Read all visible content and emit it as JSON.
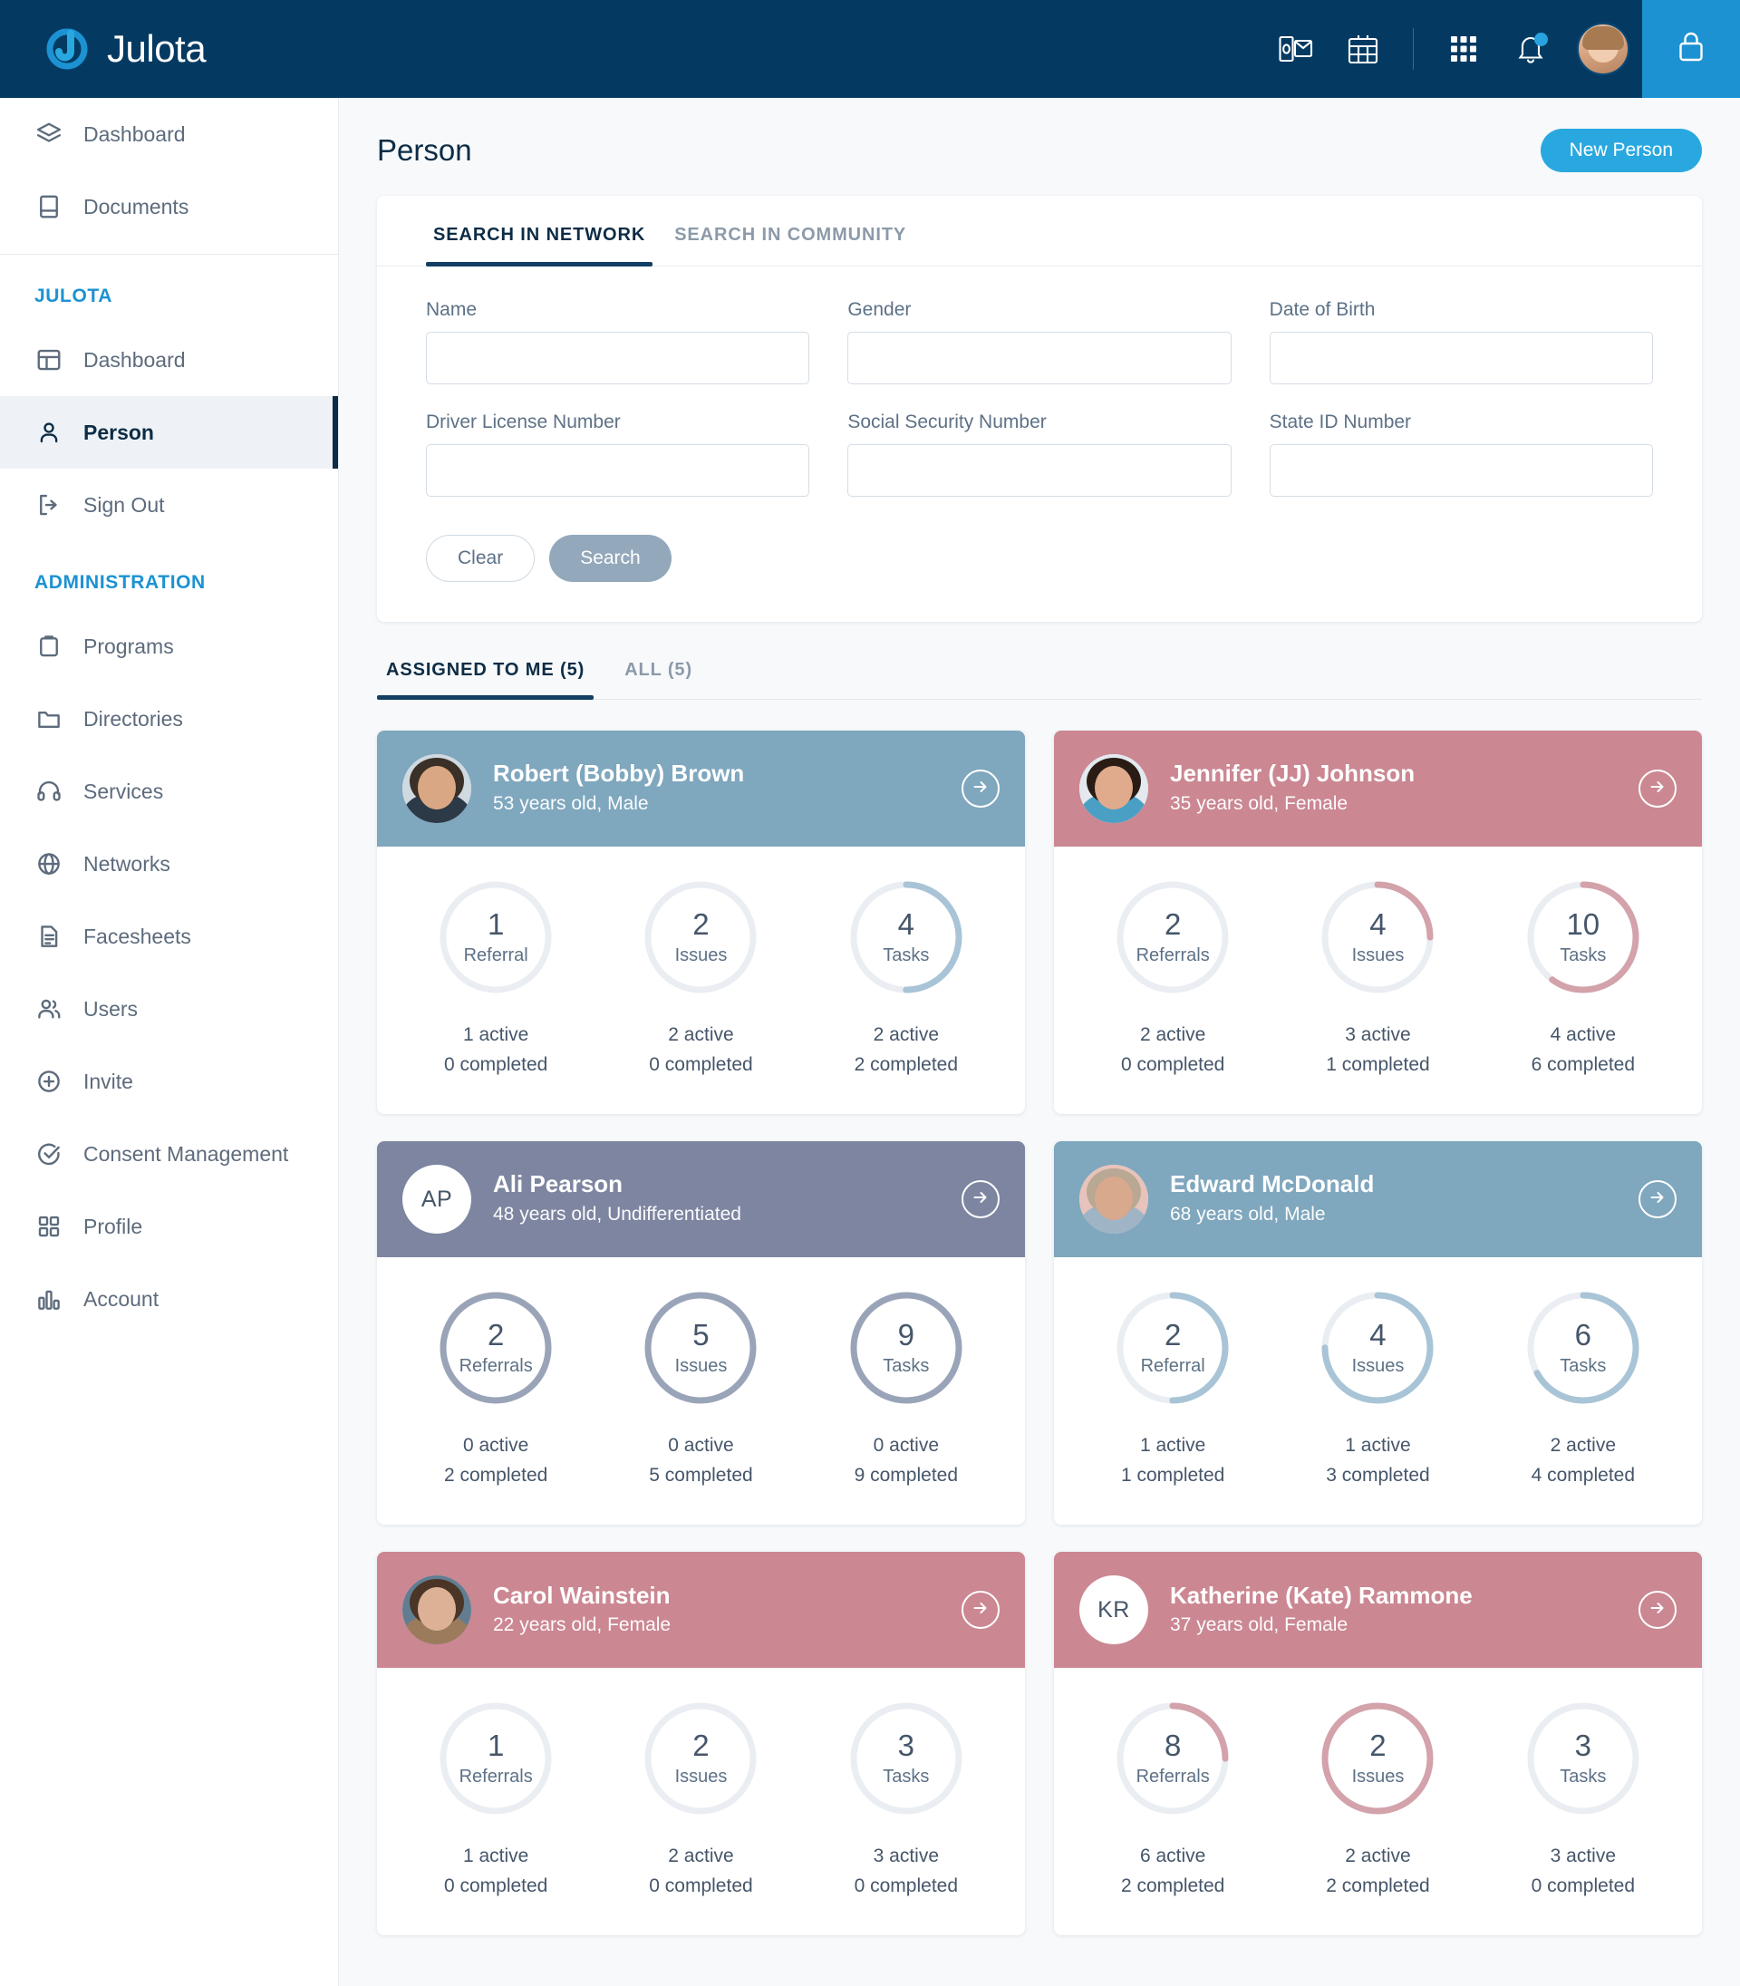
{
  "topbar": {
    "brand": "Julota",
    "icons": [
      {
        "name": "outlook-mail-icon",
        "glyph": "outlook"
      },
      {
        "name": "calendar-icon",
        "glyph": "calendar"
      },
      {
        "name": "apps-grid-icon",
        "glyph": "grid"
      },
      {
        "name": "notifications-bell-icon",
        "glyph": "bell"
      }
    ],
    "avatar_alt": "User avatar",
    "lock_icon": "lock-icon"
  },
  "sidebar": {
    "top_items": [
      {
        "label": "Dashboard",
        "icon": "layers-icon"
      },
      {
        "label": "Documents",
        "icon": "book-icon"
      }
    ],
    "sections": [
      {
        "title": "JULOTA",
        "items": [
          {
            "label": "Dashboard",
            "icon": "layout-icon",
            "active": false
          },
          {
            "label": "Person",
            "icon": "user-icon",
            "active": true
          },
          {
            "label": "Sign Out",
            "icon": "sign-out-icon",
            "active": false
          }
        ]
      },
      {
        "title": "ADMINISTRATION",
        "items": [
          {
            "label": "Programs",
            "icon": "clipboard-icon",
            "active": false
          },
          {
            "label": "Directories",
            "icon": "folder-icon",
            "active": false
          },
          {
            "label": "Services",
            "icon": "headphones-icon",
            "active": false
          },
          {
            "label": "Networks",
            "icon": "globe-icon",
            "active": false
          },
          {
            "label": "Facesheets",
            "icon": "document-text-icon",
            "active": false
          },
          {
            "label": "Users",
            "icon": "users-icon",
            "active": false
          },
          {
            "label": "Invite",
            "icon": "plus-circle-icon",
            "active": false
          },
          {
            "label": "Consent Management",
            "icon": "check-circle-icon",
            "active": false
          },
          {
            "label": "Profile",
            "icon": "grid-squares-icon",
            "active": false
          },
          {
            "label": "Account",
            "icon": "bar-chart-icon",
            "active": false
          }
        ]
      }
    ]
  },
  "page": {
    "title": "Person",
    "new_person_label": "New Person"
  },
  "search": {
    "tabs": [
      {
        "label": "SEARCH IN NETWORK",
        "active": true
      },
      {
        "label": "SEARCH IN COMMUNITY",
        "active": false
      }
    ],
    "fields": [
      {
        "label": "Name",
        "value": "",
        "type": "text",
        "name": "name-field"
      },
      {
        "label": "Gender",
        "value": "",
        "type": "select",
        "name": "gender-select"
      },
      {
        "label": "Date of Birth",
        "value": "",
        "type": "date",
        "name": "date-of-birth-field"
      },
      {
        "label": "Driver License Number",
        "value": "",
        "type": "text",
        "name": "driver-license-number-field"
      },
      {
        "label": "Social Security Number",
        "value": "",
        "type": "text",
        "name": "social-security-number-field"
      },
      {
        "label": "State ID Number",
        "value": "",
        "type": "text",
        "name": "state-id-number-field"
      }
    ],
    "clear_label": "Clear",
    "search_label": "Search"
  },
  "list": {
    "tabs": [
      {
        "label": "ASSIGNED TO ME (5)",
        "active": true
      },
      {
        "label": "ALL (5)",
        "active": false
      }
    ]
  },
  "colors": {
    "navy": "#043a62",
    "accent_blue": "#29a8e0",
    "lock_tile": "#1c92d2",
    "header_blue": "#7fa7be",
    "header_pink": "#cb8792",
    "header_slate": "#7d85a0",
    "ring_track": "#eaeef2",
    "ring_blue": "#a8c4d6",
    "ring_pink": "#d3a2aa",
    "ring_slate": "#9aa4b8",
    "sidebar_heading": "#1c92d2"
  },
  "people": [
    {
      "name": "Robert (Bobby) Brown",
      "sub": "53 years old, Male",
      "theme": "blue",
      "avatar_type": "photo",
      "photo": {
        "hair": "#3a3028",
        "skin": "#d9a784",
        "bg": "#cfd9e0",
        "body": "#2c3a47"
      },
      "initials": "",
      "stats": [
        {
          "value": "1",
          "label": "Referral",
          "active": "1 active",
          "completed": "0 completed",
          "percent": 0
        },
        {
          "value": "2",
          "label": "Issues",
          "active": "2 active",
          "completed": "0 completed",
          "percent": 0
        },
        {
          "value": "4",
          "label": "Tasks",
          "active": "2 active",
          "completed": "2 completed",
          "percent": 50
        }
      ]
    },
    {
      "name": "Jennifer (JJ) Johnson",
      "sub": "35 years old, Female",
      "theme": "pink",
      "avatar_type": "photo",
      "photo": {
        "hair": "#2a1c15",
        "skin": "#e0ab8c",
        "bg": "#e3e9ee",
        "body": "#4a9fc4"
      },
      "initials": "",
      "stats": [
        {
          "value": "2",
          "label": "Referrals",
          "active": "2 active",
          "completed": "0 completed",
          "percent": 0
        },
        {
          "value": "4",
          "label": "Issues",
          "active": "3 active",
          "completed": "1 completed",
          "percent": 25
        },
        {
          "value": "10",
          "label": "Tasks",
          "active": "4 active",
          "completed": "6 completed",
          "percent": 60
        }
      ]
    },
    {
      "name": "Ali Pearson",
      "sub": "48 years old, Undifferentiated",
      "theme": "slate",
      "avatar_type": "initials",
      "photo": null,
      "initials": "AP",
      "stats": [
        {
          "value": "2",
          "label": "Referrals",
          "active": "0 active",
          "completed": "2 completed",
          "percent": 100
        },
        {
          "value": "5",
          "label": "Issues",
          "active": "0 active",
          "completed": "5 completed",
          "percent": 100
        },
        {
          "value": "9",
          "label": "Tasks",
          "active": "0 active",
          "completed": "9 completed",
          "percent": 100
        }
      ]
    },
    {
      "name": "Edward McDonald",
      "sub": "68 years old, Male",
      "theme": "blue",
      "avatar_type": "photo",
      "photo": {
        "hair": "#b9a893",
        "skin": "#d8a98d",
        "bg": "#e8c3bb",
        "body": "#9fb4c4"
      },
      "initials": "",
      "stats": [
        {
          "value": "2",
          "label": "Referral",
          "active": "1 active",
          "completed": "1 completed",
          "percent": 50
        },
        {
          "value": "4",
          "label": "Issues",
          "active": "1 active",
          "completed": "3 completed",
          "percent": 75
        },
        {
          "value": "6",
          "label": "Tasks",
          "active": "2 active",
          "completed": "4 completed",
          "percent": 67
        }
      ]
    },
    {
      "name": "Carol Wainstein",
      "sub": "22 years old, Female",
      "theme": "pink",
      "avatar_type": "photo",
      "photo": {
        "hair": "#4a3526",
        "skin": "#dcb195",
        "bg": "#627d92",
        "body": "#9b7b5c"
      },
      "initials": "",
      "stats": [
        {
          "value": "1",
          "label": "Referrals",
          "active": "1 active",
          "completed": "0 completed",
          "percent": 0
        },
        {
          "value": "2",
          "label": "Issues",
          "active": "2 active",
          "completed": "0 completed",
          "percent": 0
        },
        {
          "value": "3",
          "label": "Tasks",
          "active": "3 active",
          "completed": "0 completed",
          "percent": 0
        }
      ]
    },
    {
      "name": "Katherine (Kate) Rammone",
      "sub": "37 years old, Female",
      "theme": "pink",
      "avatar_type": "initials",
      "photo": null,
      "initials": "KR",
      "stats": [
        {
          "value": "8",
          "label": "Referrals",
          "active": "6 active",
          "completed": "2 completed",
          "percent": 25
        },
        {
          "value": "2",
          "label": "Issues",
          "active": "2 active",
          "completed": "2 completed",
          "percent": 100
        },
        {
          "value": "3",
          "label": "Tasks",
          "active": "3 active",
          "completed": "0 completed",
          "percent": 0
        }
      ]
    }
  ]
}
